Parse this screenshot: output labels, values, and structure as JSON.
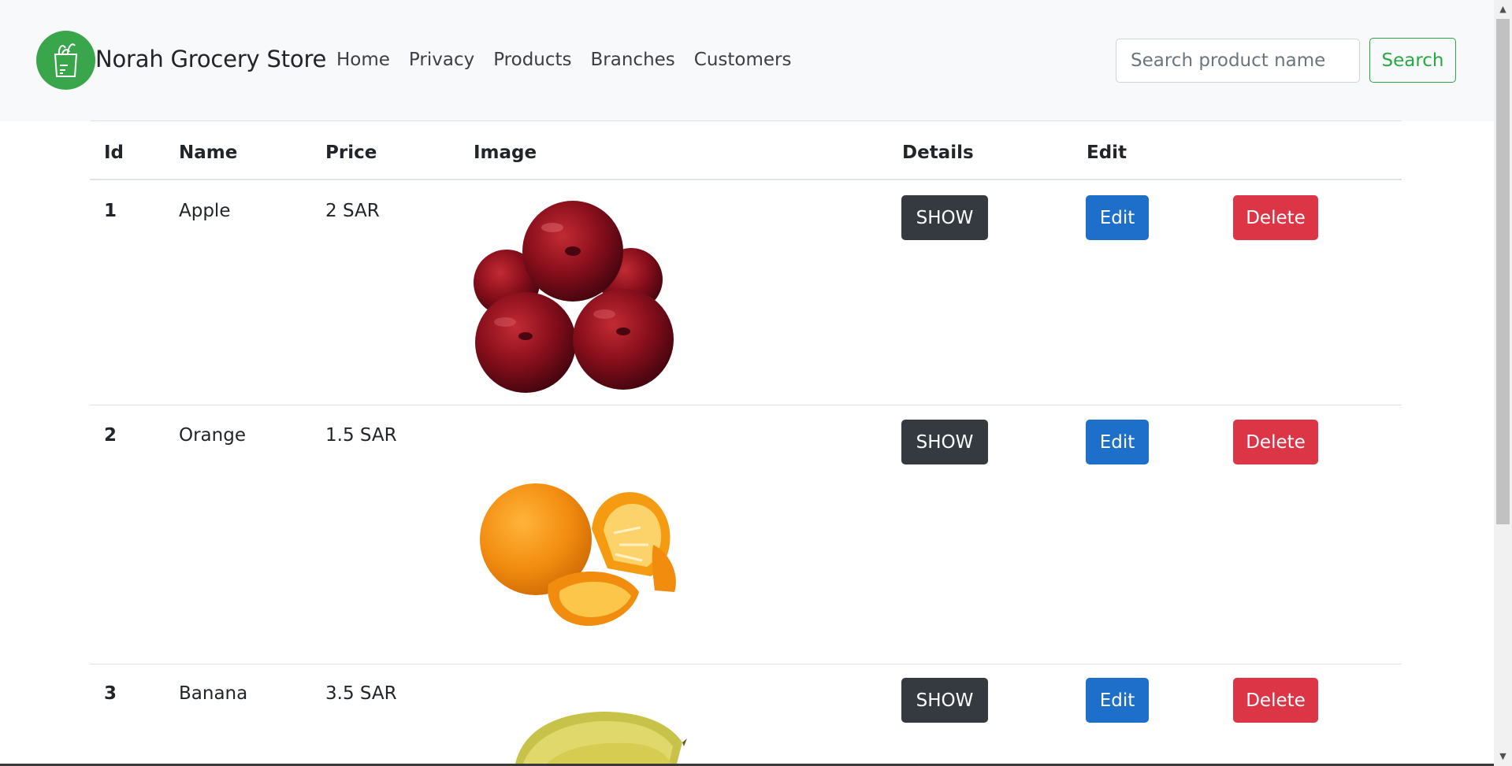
{
  "navbar": {
    "brand": "Norah Grocery Store",
    "logo_icon": "grocery-bag-icon",
    "links": [
      "Home",
      "Privacy",
      "Products",
      "Branches",
      "Customers"
    ],
    "search_placeholder": "Search product name",
    "search_label": "Search"
  },
  "table": {
    "headers": {
      "id": "Id",
      "name": "Name",
      "price": "Price",
      "image": "Image",
      "details": "Details",
      "edit": "Edit"
    },
    "rows": [
      {
        "id": "1",
        "name": "Apple",
        "price": "2 SAR",
        "image": "apples-image",
        "show": "SHOW",
        "edit": "Edit",
        "delete": "Delete"
      },
      {
        "id": "2",
        "name": "Orange",
        "price": "1.5 SAR",
        "image": "oranges-image",
        "show": "SHOW",
        "edit": "Edit",
        "delete": "Delete"
      },
      {
        "id": "3",
        "name": "Banana",
        "price": "3.5 SAR",
        "image": "bananas-image",
        "show": "SHOW",
        "edit": "Edit",
        "delete": "Delete"
      }
    ]
  },
  "colors": {
    "brand_green": "#3aa64b",
    "outline_success": "#28a745",
    "dark": "#343a40",
    "primary": "#1d6fc9",
    "danger": "#dc3545"
  }
}
